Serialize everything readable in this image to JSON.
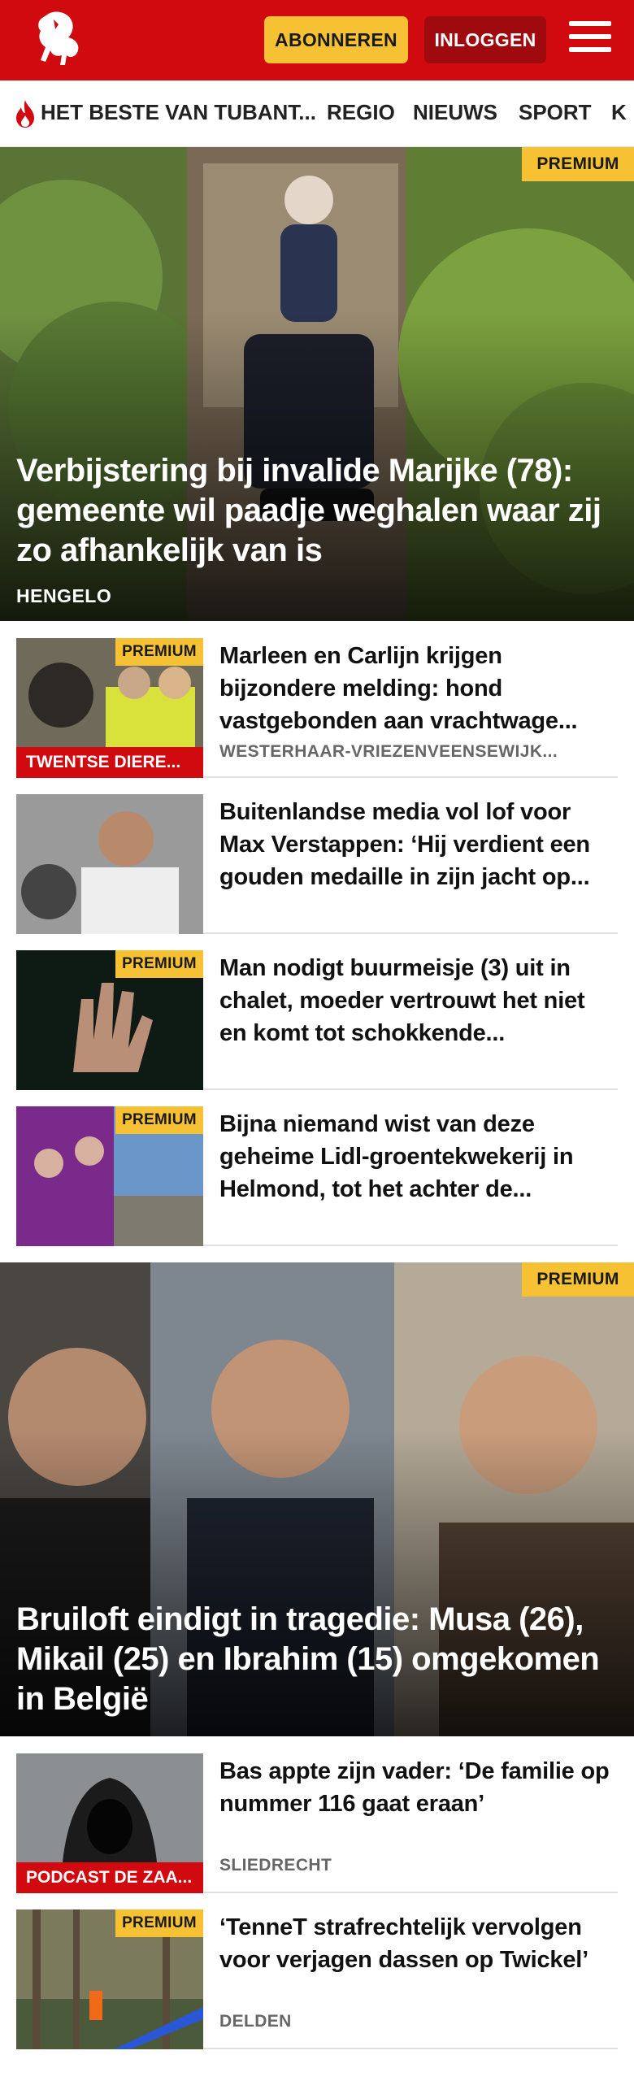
{
  "header": {
    "subscribe_label": "ABONNEREN",
    "login_label": "INLOGGEN",
    "brand_color": "#d10a10",
    "accent_color": "#f6c233"
  },
  "nav": {
    "items": [
      "HET BESTE VAN TUBANT...",
      "REGIO",
      "NIEUWS",
      "SPORT",
      "K"
    ]
  },
  "articles": {
    "hero1": {
      "badge": "PREMIUM",
      "title": "Verbijstering bij invalide Marijke (78): gemeente wil paadje weghalen waar zij zo afhankelijk van is",
      "location": "HENGELO"
    },
    "list1": [
      {
        "badge": "PREMIUM",
        "tag": "TWENTSE DIERE...",
        "title": "Marleen en Carlijn krijgen bijzondere melding: hond vastgebonden aan vrachtwage...",
        "location": "WESTERHAAR-VRIEZENVEENSEWIJK..."
      },
      {
        "badge": "",
        "tag": "",
        "title": "Buitenlandse media vol lof voor Max Verstappen: ‘Hij verdient een gouden medaille in zijn jacht op...",
        "location": ""
      },
      {
        "badge": "PREMIUM",
        "tag": "",
        "title": "Man nodigt buurmeisje (3) uit in chalet, moeder vertrouwt het niet en komt tot schokkende...",
        "location": ""
      },
      {
        "badge": "PREMIUM",
        "tag": "",
        "title": "Bijna niemand wist van deze geheime Lidl-groentekwekerij in Helmond, tot het achter de...",
        "location": ""
      }
    ],
    "hero2": {
      "badge": "PREMIUM",
      "title": "Bruiloft eindigt in tragedie: Musa (26), Mikail (25) en Ibrahim (15) omgekomen in België",
      "location": ""
    },
    "list2": [
      {
        "badge": "",
        "tag": "PODCAST DE ZAA...",
        "title": "Bas appte zijn vader: ‘De familie op nummer 116 gaat eraan’",
        "location": "SLIEDRECHT"
      },
      {
        "badge": "PREMIUM",
        "tag": "",
        "title": "‘TenneT strafrechtelijk vervolgen voor verjagen dassen op Twickel’",
        "location": "DELDEN"
      }
    ]
  }
}
